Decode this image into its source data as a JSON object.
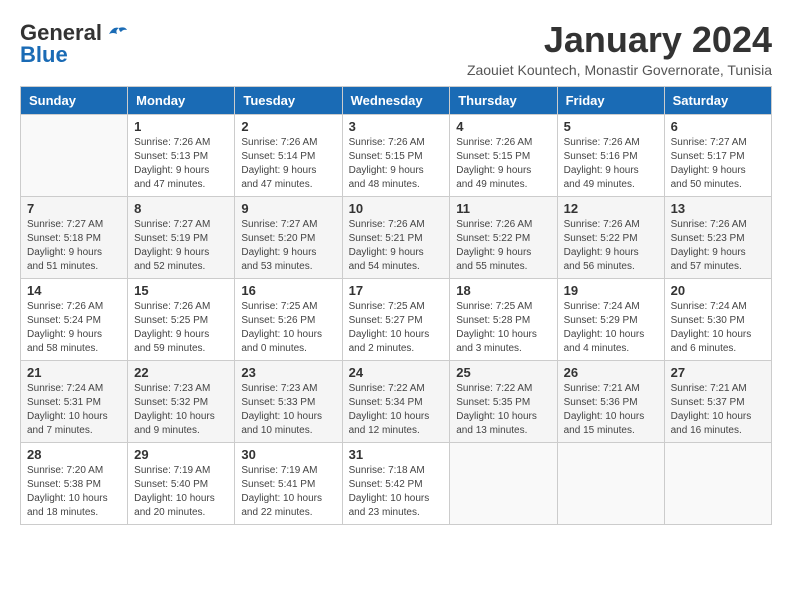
{
  "header": {
    "logo_general": "General",
    "logo_blue": "Blue",
    "month_title": "January 2024",
    "location": "Zaouiet Kountech, Monastir Governorate, Tunisia"
  },
  "days_of_week": [
    "Sunday",
    "Monday",
    "Tuesday",
    "Wednesday",
    "Thursday",
    "Friday",
    "Saturday"
  ],
  "weeks": [
    [
      {
        "day": "",
        "info": ""
      },
      {
        "day": "1",
        "info": "Sunrise: 7:26 AM\nSunset: 5:13 PM\nDaylight: 9 hours\nand 47 minutes."
      },
      {
        "day": "2",
        "info": "Sunrise: 7:26 AM\nSunset: 5:14 PM\nDaylight: 9 hours\nand 47 minutes."
      },
      {
        "day": "3",
        "info": "Sunrise: 7:26 AM\nSunset: 5:15 PM\nDaylight: 9 hours\nand 48 minutes."
      },
      {
        "day": "4",
        "info": "Sunrise: 7:26 AM\nSunset: 5:15 PM\nDaylight: 9 hours\nand 49 minutes."
      },
      {
        "day": "5",
        "info": "Sunrise: 7:26 AM\nSunset: 5:16 PM\nDaylight: 9 hours\nand 49 minutes."
      },
      {
        "day": "6",
        "info": "Sunrise: 7:27 AM\nSunset: 5:17 PM\nDaylight: 9 hours\nand 50 minutes."
      }
    ],
    [
      {
        "day": "7",
        "info": "Sunrise: 7:27 AM\nSunset: 5:18 PM\nDaylight: 9 hours\nand 51 minutes."
      },
      {
        "day": "8",
        "info": "Sunrise: 7:27 AM\nSunset: 5:19 PM\nDaylight: 9 hours\nand 52 minutes."
      },
      {
        "day": "9",
        "info": "Sunrise: 7:27 AM\nSunset: 5:20 PM\nDaylight: 9 hours\nand 53 minutes."
      },
      {
        "day": "10",
        "info": "Sunrise: 7:26 AM\nSunset: 5:21 PM\nDaylight: 9 hours\nand 54 minutes."
      },
      {
        "day": "11",
        "info": "Sunrise: 7:26 AM\nSunset: 5:22 PM\nDaylight: 9 hours\nand 55 minutes."
      },
      {
        "day": "12",
        "info": "Sunrise: 7:26 AM\nSunset: 5:22 PM\nDaylight: 9 hours\nand 56 minutes."
      },
      {
        "day": "13",
        "info": "Sunrise: 7:26 AM\nSunset: 5:23 PM\nDaylight: 9 hours\nand 57 minutes."
      }
    ],
    [
      {
        "day": "14",
        "info": "Sunrise: 7:26 AM\nSunset: 5:24 PM\nDaylight: 9 hours\nand 58 minutes."
      },
      {
        "day": "15",
        "info": "Sunrise: 7:26 AM\nSunset: 5:25 PM\nDaylight: 9 hours\nand 59 minutes."
      },
      {
        "day": "16",
        "info": "Sunrise: 7:25 AM\nSunset: 5:26 PM\nDaylight: 10 hours\nand 0 minutes."
      },
      {
        "day": "17",
        "info": "Sunrise: 7:25 AM\nSunset: 5:27 PM\nDaylight: 10 hours\nand 2 minutes."
      },
      {
        "day": "18",
        "info": "Sunrise: 7:25 AM\nSunset: 5:28 PM\nDaylight: 10 hours\nand 3 minutes."
      },
      {
        "day": "19",
        "info": "Sunrise: 7:24 AM\nSunset: 5:29 PM\nDaylight: 10 hours\nand 4 minutes."
      },
      {
        "day": "20",
        "info": "Sunrise: 7:24 AM\nSunset: 5:30 PM\nDaylight: 10 hours\nand 6 minutes."
      }
    ],
    [
      {
        "day": "21",
        "info": "Sunrise: 7:24 AM\nSunset: 5:31 PM\nDaylight: 10 hours\nand 7 minutes."
      },
      {
        "day": "22",
        "info": "Sunrise: 7:23 AM\nSunset: 5:32 PM\nDaylight: 10 hours\nand 9 minutes."
      },
      {
        "day": "23",
        "info": "Sunrise: 7:23 AM\nSunset: 5:33 PM\nDaylight: 10 hours\nand 10 minutes."
      },
      {
        "day": "24",
        "info": "Sunrise: 7:22 AM\nSunset: 5:34 PM\nDaylight: 10 hours\nand 12 minutes."
      },
      {
        "day": "25",
        "info": "Sunrise: 7:22 AM\nSunset: 5:35 PM\nDaylight: 10 hours\nand 13 minutes."
      },
      {
        "day": "26",
        "info": "Sunrise: 7:21 AM\nSunset: 5:36 PM\nDaylight: 10 hours\nand 15 minutes."
      },
      {
        "day": "27",
        "info": "Sunrise: 7:21 AM\nSunset: 5:37 PM\nDaylight: 10 hours\nand 16 minutes."
      }
    ],
    [
      {
        "day": "28",
        "info": "Sunrise: 7:20 AM\nSunset: 5:38 PM\nDaylight: 10 hours\nand 18 minutes."
      },
      {
        "day": "29",
        "info": "Sunrise: 7:19 AM\nSunset: 5:40 PM\nDaylight: 10 hours\nand 20 minutes."
      },
      {
        "day": "30",
        "info": "Sunrise: 7:19 AM\nSunset: 5:41 PM\nDaylight: 10 hours\nand 22 minutes."
      },
      {
        "day": "31",
        "info": "Sunrise: 7:18 AM\nSunset: 5:42 PM\nDaylight: 10 hours\nand 23 minutes."
      },
      {
        "day": "",
        "info": ""
      },
      {
        "day": "",
        "info": ""
      },
      {
        "day": "",
        "info": ""
      }
    ]
  ]
}
